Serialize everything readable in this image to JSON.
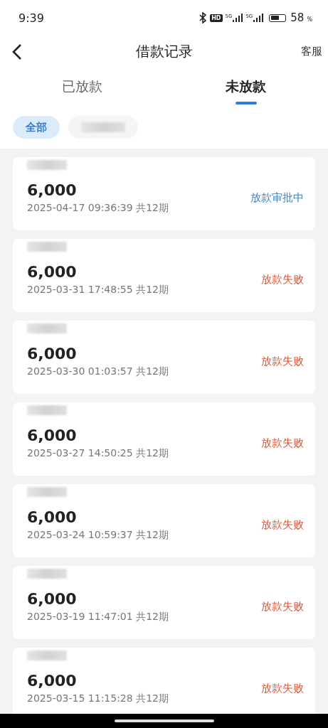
{
  "status_bar": {
    "time": "9:39",
    "hd_label": "HD",
    "network_labels": [
      "5G",
      "5G"
    ],
    "battery": "58",
    "battery_unit": "%"
  },
  "nav": {
    "title": "借款记录",
    "action": "客服"
  },
  "tabs": [
    {
      "label": "已放款",
      "selected": false
    },
    {
      "label": "未放款",
      "selected": true
    }
  ],
  "filters": [
    {
      "kind": "text",
      "label": "全部",
      "selected": true
    },
    {
      "kind": "blurred",
      "selected": false
    }
  ],
  "records": [
    {
      "amount": "6,000",
      "detail": "2025-04-17 09:36:39 共12期",
      "status": "放款审批中",
      "kind": "pending"
    },
    {
      "amount": "6,000",
      "detail": "2025-03-31 17:48:55 共12期",
      "status": "放款失败",
      "kind": "failed"
    },
    {
      "amount": "6,000",
      "detail": "2025-03-30 01:03:57 共12期",
      "status": "放款失败",
      "kind": "failed"
    },
    {
      "amount": "6,000",
      "detail": "2025-03-27 14:50:25 共12期",
      "status": "放款失败",
      "kind": "failed"
    },
    {
      "amount": "6,000",
      "detail": "2025-03-24 10:59:37 共12期",
      "status": "放款失败",
      "kind": "failed"
    },
    {
      "amount": "6,000",
      "detail": "2025-03-19 11:47:01 共12期",
      "status": "放款失败",
      "kind": "failed"
    },
    {
      "amount": "6,000",
      "detail": "2025-03-15 11:15:28 共12期",
      "status": "放款失败",
      "kind": "failed"
    }
  ]
}
